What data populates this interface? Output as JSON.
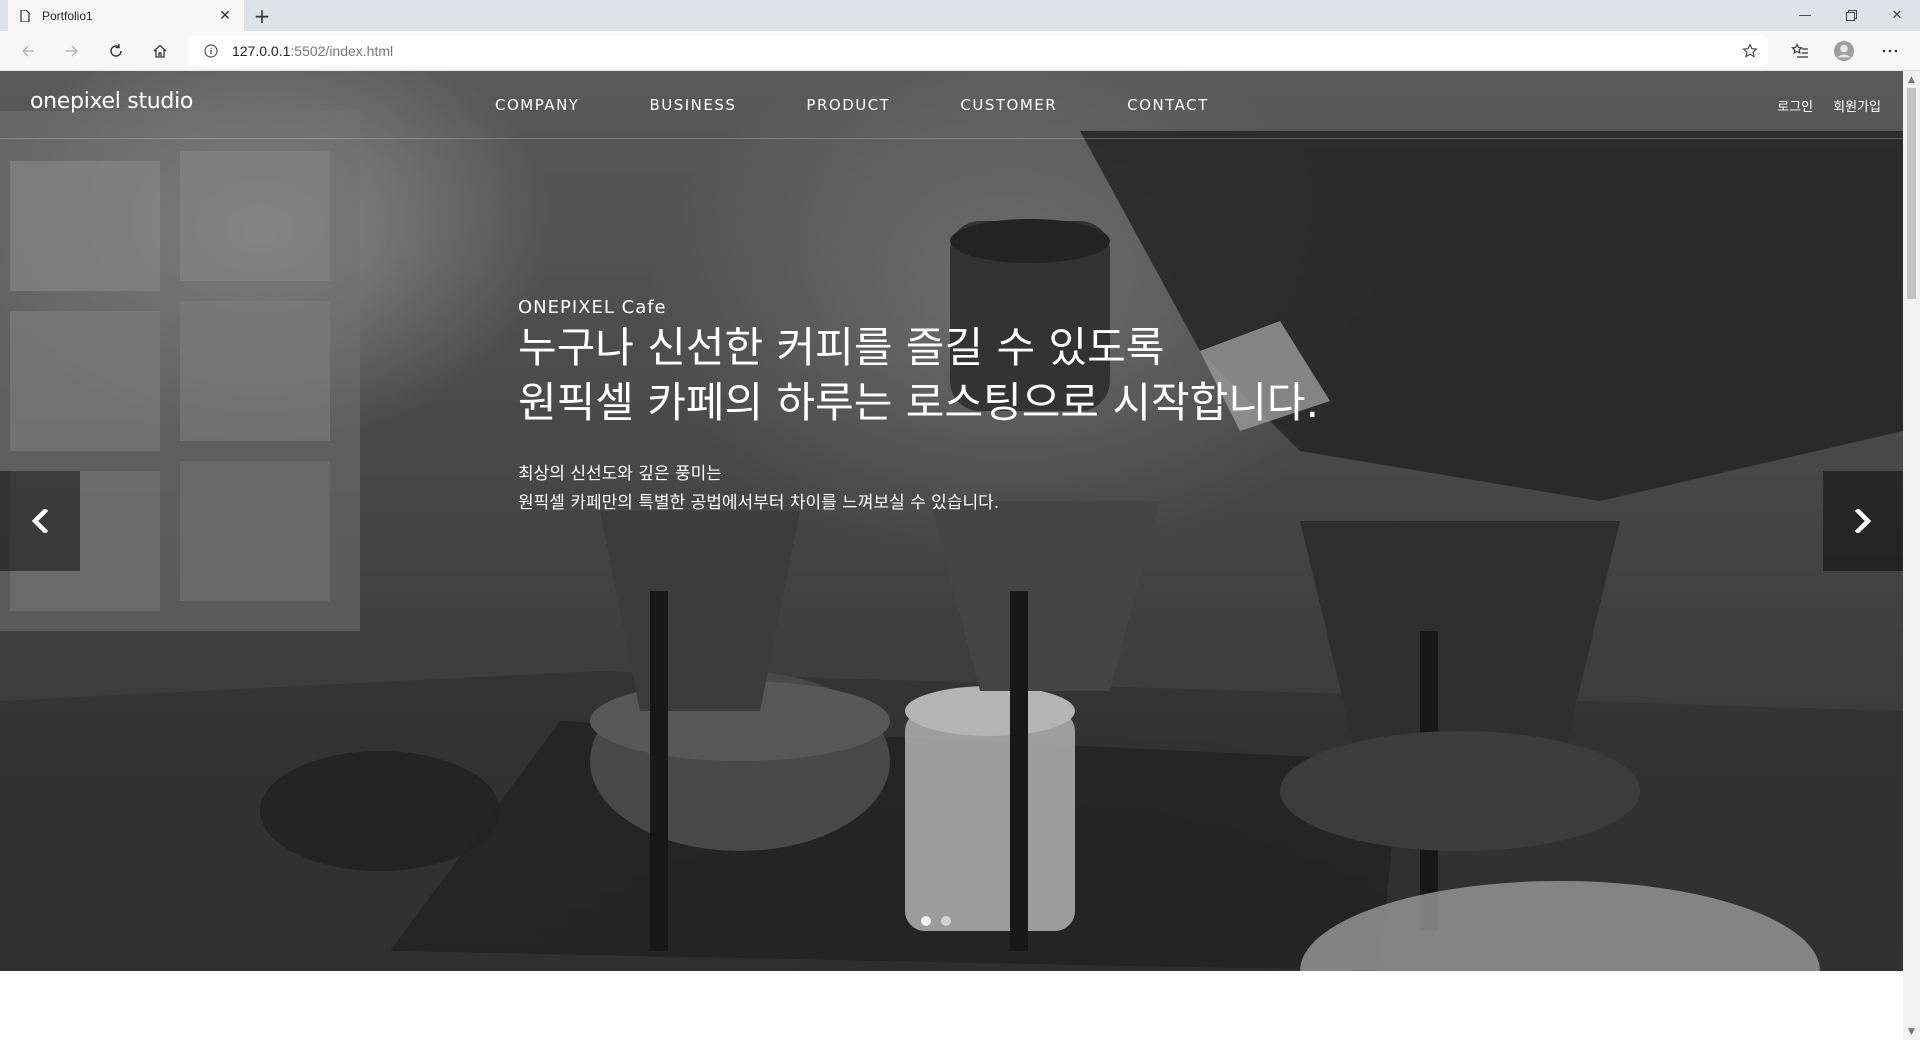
{
  "browser": {
    "tab_title": "Portfolio1",
    "new_tab_label": "+",
    "url_host": "127.0.0.1",
    "url_rest": ":5502/index.html",
    "icons": {
      "favicon": "page-icon",
      "close": "close-icon",
      "back": "back-arrow-icon",
      "forward": "forward-arrow-icon",
      "refresh": "refresh-icon",
      "home": "home-icon",
      "info": "info-icon",
      "favorite": "star-icon",
      "collections": "favorites-list-icon",
      "profile": "profile-icon",
      "menu": "more-icon"
    }
  },
  "header": {
    "logo": "onepixel studio",
    "nav": [
      "COMPANY",
      "BUSINESS",
      "PRODUCT",
      "CUSTOMER",
      "CONTACT"
    ],
    "util": [
      "로그인",
      "회원가입"
    ]
  },
  "slide": {
    "eyebrow": "ONEPIXEL Cafe",
    "headline_line1": "누구나 신선한 커피를 즐길 수 있도록",
    "headline_line2": "원픽셀 카페의 하루는 로스팅으로 시작합니다.",
    "desc_line1": "최상의 신선도와 깊은 풍미는",
    "desc_line2": "원픽셀 카페만의 특별한 공법에서부터 차이를 느껴보실 수 있습니다.",
    "total_slides": 2,
    "active_slide": 1
  },
  "colors": {
    "header_text": "#ffffff",
    "tabbar_bg": "#dee1e6",
    "toolbar_bg": "#f7f7f7"
  }
}
